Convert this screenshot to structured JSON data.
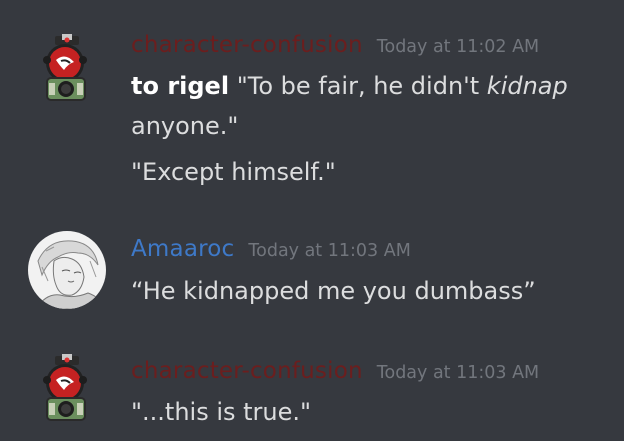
{
  "messages": [
    {
      "username": "character-confusion",
      "username_color": "#6b1e1e",
      "timestamp": "Today at 11:02 AM",
      "avatar": "redguard-robot-avatar",
      "lines": [
        {
          "prefix": "to rigel",
          "text_before": " \"To be fair, he didn't ",
          "italic": "kidnap",
          "text_after": " anyone.\""
        },
        {
          "text": "\"Except himself.\""
        }
      ]
    },
    {
      "username": "Amaaroc",
      "username_color": "#3e79c8",
      "timestamp": "Today at 11:03 AM",
      "avatar": "sketch-portrait-avatar",
      "lines": [
        {
          "text": "“He kidnapped me you dumbass”"
        }
      ]
    },
    {
      "username": "character-confusion",
      "username_color": "#6b1e1e",
      "timestamp": "Today at 11:03 AM",
      "avatar": "redguard-robot-avatar",
      "lines": [
        {
          "text": "\"...this is true.\""
        }
      ]
    }
  ]
}
